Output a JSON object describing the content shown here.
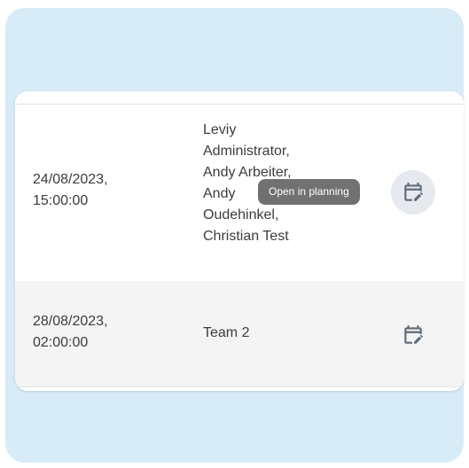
{
  "rows": [
    {
      "date": "24/08/2023,\n15:00:00",
      "assignees": [
        "Leviy",
        "Administrator,",
        "Andy Arbeiter,",
        "Andy",
        "Oudehinkel,",
        "Christian Test"
      ],
      "action_icon": "calendar-edit-icon",
      "hovered": true
    },
    {
      "date": "28/08/2023,\n02:00:00",
      "assignees": [
        "Team 2"
      ],
      "action_icon": "calendar-edit-icon",
      "hovered": false
    }
  ],
  "tooltip": {
    "text": "Open in planning"
  },
  "colors": {
    "panel_bg": "#d8ecf8",
    "icon": "#5f6b77",
    "tooltip_bg": "#666666"
  }
}
